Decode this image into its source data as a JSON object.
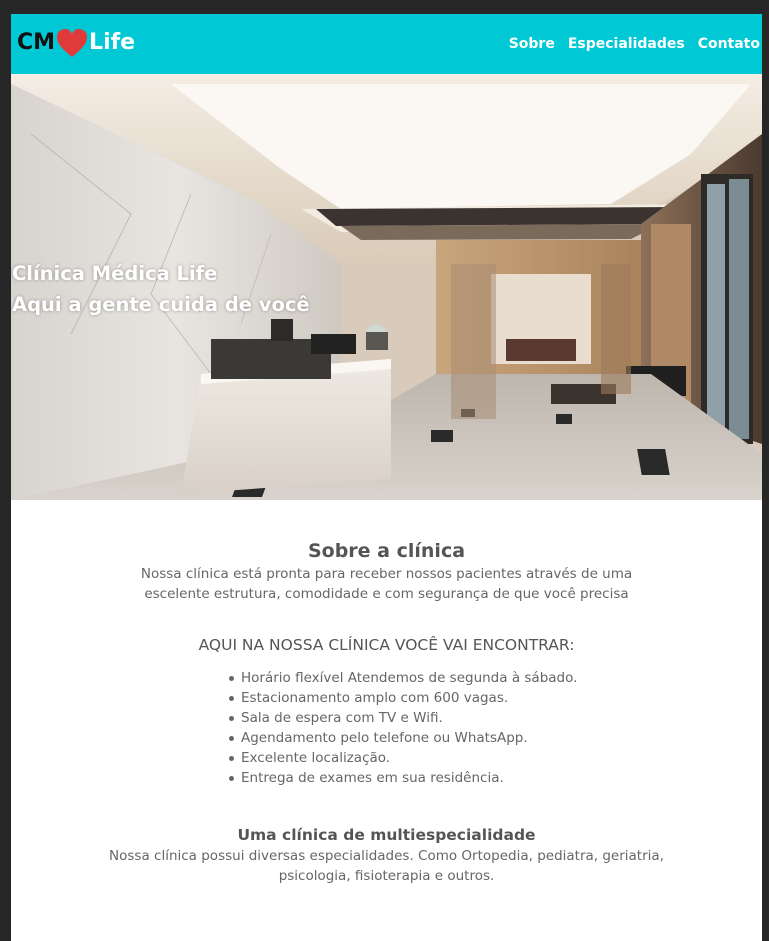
{
  "header": {
    "logo": {
      "part1": "CM",
      "part2": "Life",
      "heart_icon": "heart-icon",
      "heart_color": "#e03a3a"
    },
    "background_color": "#00c8d4",
    "nav": [
      {
        "label": "Sobre"
      },
      {
        "label": "Especialidades"
      },
      {
        "label": "Contato"
      }
    ]
  },
  "hero": {
    "line1": "Clínica Médica Life",
    "line2": "Aqui a gente cuida de você"
  },
  "about": {
    "title": "Sobre a clínica",
    "text": "Nossa clínica está pronta para receber nossos pacientes através de uma escelente estrutura, comodidade e com segurança de que você precisa"
  },
  "features": {
    "heading": "AQUI NA NOSSA CLÍNICA VOCÊ VAI ENCONTRAR:",
    "items": [
      "Horário flexível Atendemos de segunda à sábado.",
      "Estacionamento amplo com 600 vagas.",
      "Sala de espera com TV e Wifi.",
      "Agendamento pelo telefone ou WhatsApp.",
      "Excelente localização.",
      "Entrega de exames em sua residência."
    ]
  },
  "multi": {
    "title": "Uma clínica de multiespecialidade",
    "text": "Nossa clínica possui diversas especialidades. Como Ortopedia, pediatra, geriatria, psicologia, fisioterapia e outros."
  }
}
